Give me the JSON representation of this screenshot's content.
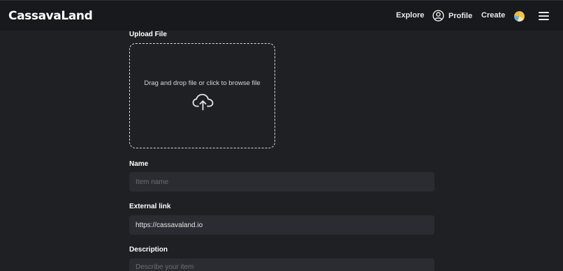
{
  "header": {
    "logo": "CassavaLand",
    "nav": {
      "explore": "Explore",
      "profile": "Profile",
      "create": "Create"
    }
  },
  "form": {
    "upload": {
      "label": "Upload File",
      "prompt": "Drag and drop file or click to browse file"
    },
    "name": {
      "label": "Name",
      "placeholder": "Item name",
      "value": ""
    },
    "external_link": {
      "label": "External link",
      "value": "https://cassavaland.io"
    },
    "description": {
      "label": "Description",
      "placeholder": "Describe your item"
    }
  },
  "icons": {
    "profile": "user-circle-icon",
    "wallet": "wallet-avatar-icon",
    "menu": "hamburger-menu-icon",
    "upload": "cloud-upload-icon"
  },
  "colors": {
    "background": "#1f2024",
    "header": "#18191c",
    "input": "#2b2c31"
  }
}
